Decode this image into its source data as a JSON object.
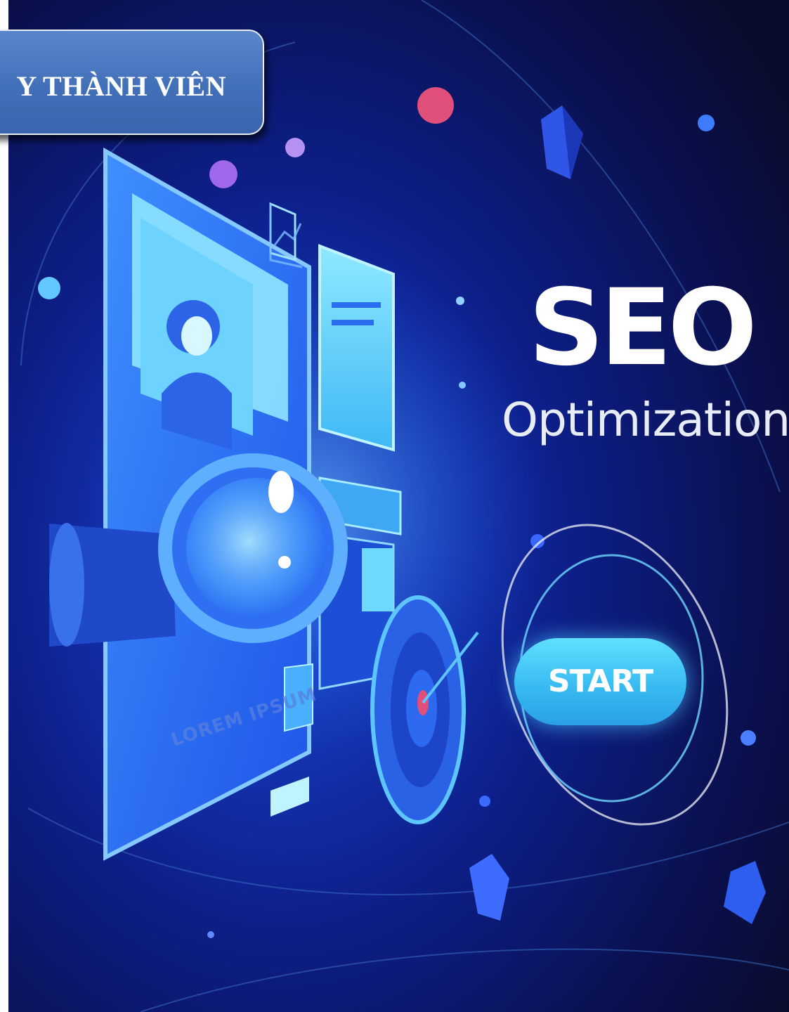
{
  "banner": {
    "label": "Y THÀNH VIÊN"
  },
  "hero": {
    "title": "SEO",
    "subtitle": "Optimization",
    "start_label": "START",
    "screen_placeholder": "LOREM IPSUM"
  },
  "colors": {
    "background": "#0a0e3a",
    "accent": "#36b8f0",
    "banner": "#4270b8"
  },
  "icons": [
    "magnifier-icon",
    "target-icon",
    "arrow-icon",
    "search-icon",
    "play-icon",
    "chart-icon"
  ]
}
